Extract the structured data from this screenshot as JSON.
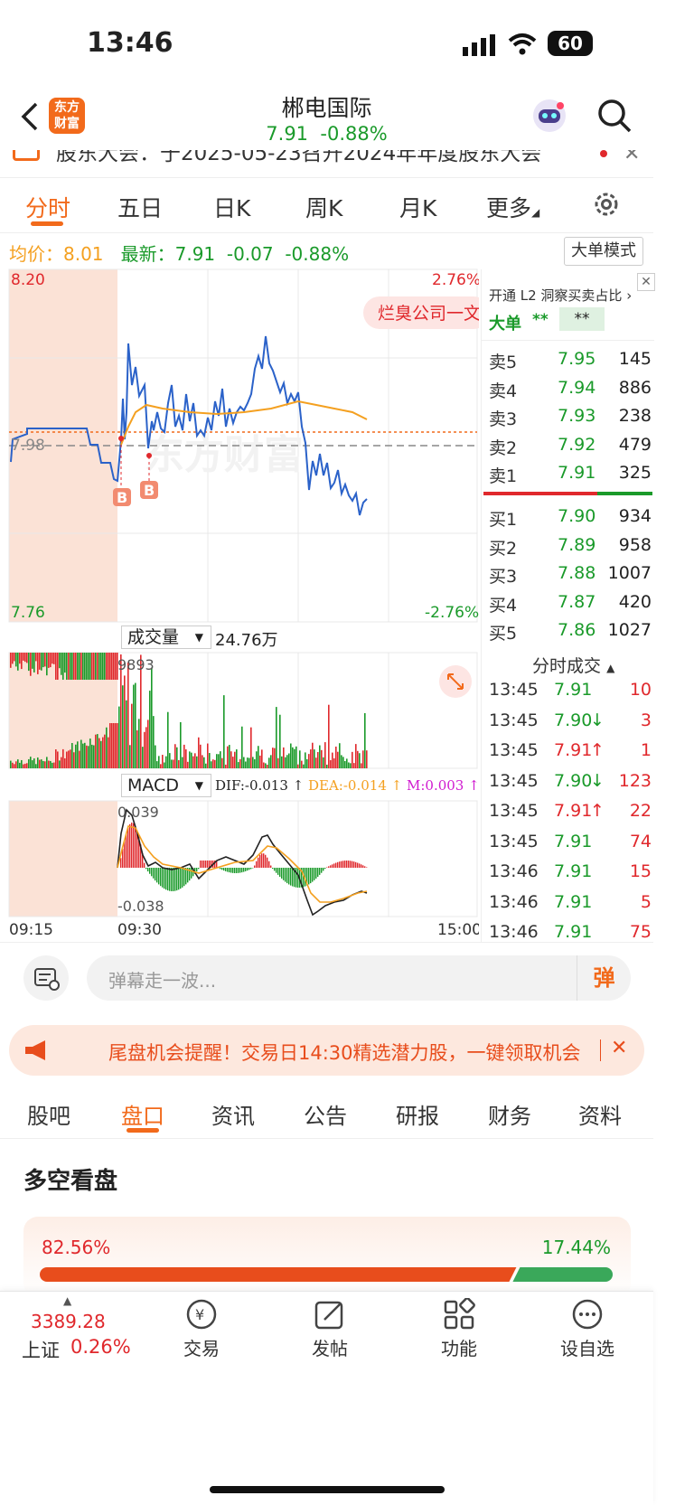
{
  "status": {
    "time": "13:46",
    "battery": "60"
  },
  "header": {
    "title": "郴电国际",
    "price": "7.91",
    "change": "-0.88%",
    "logo": "东方财富"
  },
  "notice": {
    "text": "股东大会：于2025-05-23召开2024年年度股东大会"
  },
  "chart_tabs": [
    "分时",
    "五日",
    "日K",
    "周K",
    "月K",
    "更多"
  ],
  "info_line": {
    "avg_label": "均价：",
    "avg": "8.01",
    "latest_label": "最新：",
    "latest": "7.91",
    "delta": "-0.07",
    "pct": "-0.88%",
    "mode_button": "大单模式"
  },
  "chart": {
    "top_price": "8.20",
    "top_pct": "2.76%",
    "bottom_price": "7.76",
    "bottom_pct": "-2.76%",
    "mid_price": "7.98",
    "watermark": "东方财富",
    "hot_tag": "烂臭公司一文",
    "marker": "B",
    "volume_label": "成交量",
    "volume_value": "24.76万",
    "volume_max": "9893",
    "macd_label": "MACD",
    "dif": "DIF:-0.013",
    "dea": "DEA:-0.014",
    "m": "M:0.003",
    "macd_top": "0.039",
    "macd_bottom": "-0.038",
    "t_start": "09:15",
    "t_open": "09:30",
    "t_end": "15:00"
  },
  "level2": {
    "promo": "开通 L2 洞察买卖占比",
    "big_label": "大单",
    "big_v1": "**",
    "big_v2": "**"
  },
  "asks": [
    {
      "label": "卖5",
      "price": "7.95",
      "vol": "145"
    },
    {
      "label": "卖4",
      "price": "7.94",
      "vol": "886"
    },
    {
      "label": "卖3",
      "price": "7.93",
      "vol": "238"
    },
    {
      "label": "卖2",
      "price": "7.92",
      "vol": "479"
    },
    {
      "label": "卖1",
      "price": "7.91",
      "vol": "325"
    }
  ],
  "bids": [
    {
      "label": "买1",
      "price": "7.90",
      "vol": "934"
    },
    {
      "label": "买2",
      "price": "7.89",
      "vol": "958"
    },
    {
      "label": "买3",
      "price": "7.88",
      "vol": "1007"
    },
    {
      "label": "买4",
      "price": "7.87",
      "vol": "420"
    },
    {
      "label": "买5",
      "price": "7.86",
      "vol": "1027"
    }
  ],
  "ticks_title": "分时成交",
  "ticks": [
    {
      "t": "13:45",
      "p": "7.91",
      "v": "10",
      "d": ""
    },
    {
      "t": "13:45",
      "p": "7.90",
      "v": "3",
      "d": "↓"
    },
    {
      "t": "13:45",
      "p": "7.91",
      "v": "1",
      "d": "↑"
    },
    {
      "t": "13:45",
      "p": "7.90",
      "v": "123",
      "d": "↓"
    },
    {
      "t": "13:45",
      "p": "7.91",
      "v": "22",
      "d": "↑"
    },
    {
      "t": "13:45",
      "p": "7.91",
      "v": "74",
      "d": ""
    },
    {
      "t": "13:46",
      "p": "7.91",
      "v": "15",
      "d": ""
    },
    {
      "t": "13:46",
      "p": "7.91",
      "v": "5",
      "d": ""
    },
    {
      "t": "13:46",
      "p": "7.91",
      "v": "75",
      "d": ""
    }
  ],
  "comment": {
    "placeholder": "弹幕走一波...",
    "send": "弹"
  },
  "banner": {
    "text": "尾盘机会提醒！交易日14:30精选潜力股，一键领取机会"
  },
  "bottom_tabs": [
    "股吧",
    "盘口",
    "资讯",
    "公告",
    "研报",
    "财务",
    "资料"
  ],
  "sentiment": {
    "title": "多空看盘",
    "bull": "82.56%",
    "bear": "17.44%",
    "bull_ratio": 0.8256
  },
  "nav": {
    "index_value": "3389.28",
    "index_name": "上证",
    "index_pct": "0.26%",
    "items": [
      "交易",
      "发帖",
      "功能",
      "设自选"
    ]
  },
  "colors": {
    "red": "#e0282c",
    "green": "#1a9a2a",
    "orange": "#f26a1b",
    "avg": "#f4a020",
    "price": "#2b62c9"
  }
}
